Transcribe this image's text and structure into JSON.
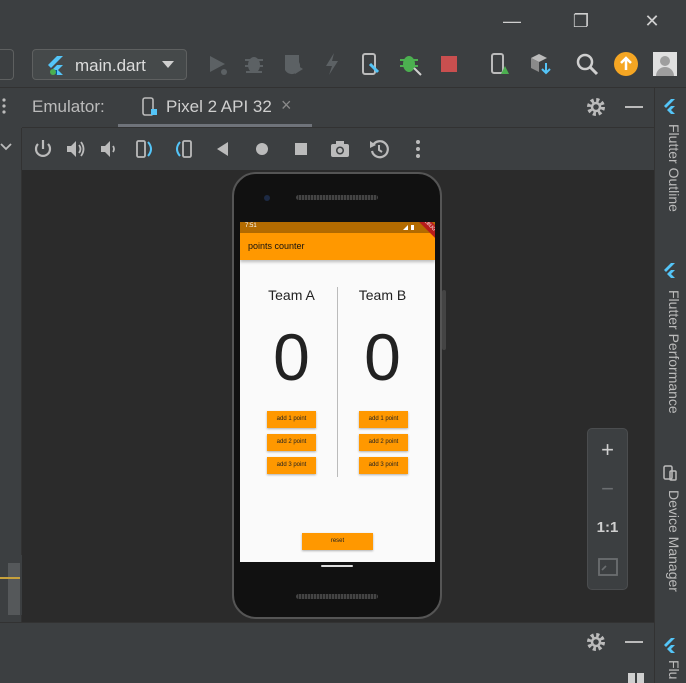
{
  "window": {
    "minimize_glyph": "—",
    "maximize_glyph": "❐",
    "close_glyph": "✕"
  },
  "toolbar": {
    "device_selector_label": "main.dart",
    "icons": [
      "flutter-icon",
      "run-icon",
      "debug-icon",
      "profile-icon",
      "hot-reload-icon",
      "hot-restart-icon",
      "flutter-inspector-icon",
      "stop-icon",
      "device-manager-icon",
      "sdk-manager-icon",
      "search-icon",
      "update-icon",
      "avatar"
    ]
  },
  "emulator": {
    "title": "Emulator:",
    "tab_label": "Pixel 2 API 32",
    "tab_close": "×"
  },
  "phone": {
    "status_time": "7:51",
    "app_title": "points counter",
    "debug_banner": "DEBUG",
    "team_a": {
      "name": "Team A",
      "score": "0"
    },
    "team_b": {
      "name": "Team B",
      "score": "0"
    },
    "buttons": [
      "add 1 point",
      "add 2 point",
      "add 3 point"
    ],
    "reset_label": "reset"
  },
  "zoom": {
    "plus": "+",
    "minus": "−",
    "one_to_one": "1:1"
  },
  "right_tabs": {
    "outline": "Flutter Outline",
    "performance": "Flutter Performance",
    "device_manager": "Device Manager",
    "flutter_inspector_partial": "Flu"
  },
  "colors": {
    "ide_bg": "#3c3f41",
    "device_area_bg": "#2b2b2b",
    "accent_orange": "#ff9800",
    "status_orange": "#b36b00",
    "update_badge": "#f5a623",
    "stop_red": "#c94f4f"
  }
}
